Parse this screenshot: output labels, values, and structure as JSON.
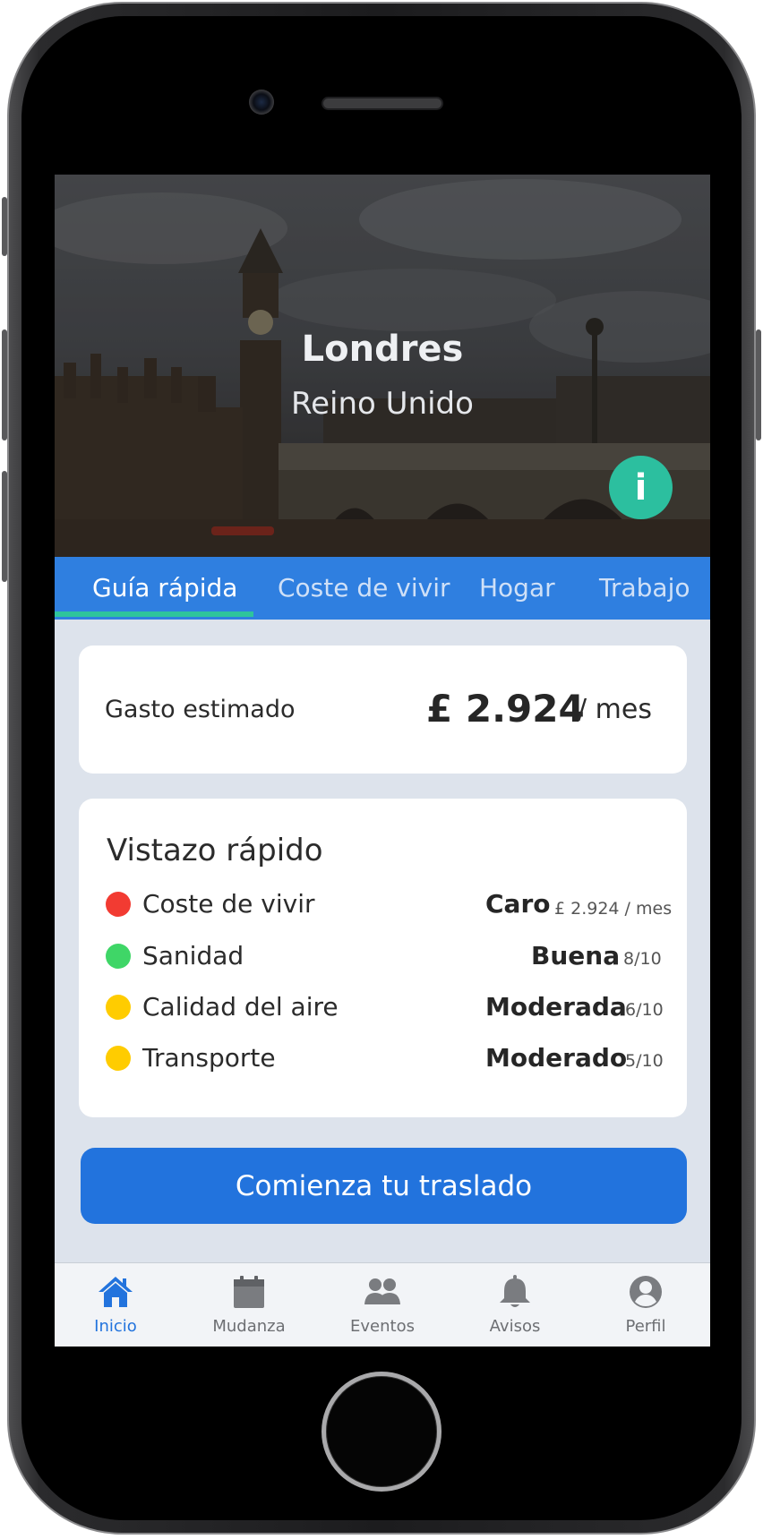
{
  "hero": {
    "city": "Londres",
    "country": "Reino Unido",
    "info_icon": "info-icon",
    "info_label": "i"
  },
  "tabs": [
    {
      "label": "Guía rápida",
      "active": true
    },
    {
      "label": "Coste de vivir",
      "active": false
    },
    {
      "label": "Hogar",
      "active": false
    },
    {
      "label": "Trabajo",
      "active": false
    }
  ],
  "gasto": {
    "label": "Gasto estimado",
    "amount": "£ 2.924",
    "period": "/ mes"
  },
  "vistazo": {
    "title": "Vistazo rápido",
    "rows": [
      {
        "label": "Coste de vivir",
        "rating": "Caro",
        "detail": "£ 2.924 / mes",
        "status_color": "#f23b32"
      },
      {
        "label": "Sanidad",
        "rating": "Buena",
        "detail": "8/10",
        "status_color": "#3fd667"
      },
      {
        "label": "Calidad del aire",
        "rating": "Moderada",
        "detail": "6/10",
        "status_color": "#ffcc00"
      },
      {
        "label": "Transporte",
        "rating": "Moderado",
        "detail": "5/10",
        "status_color": "#ffcc00"
      }
    ]
  },
  "cta": {
    "label": "Comienza tu traslado"
  },
  "nav": [
    {
      "label": "Inicio",
      "icon": "home-icon",
      "active": true
    },
    {
      "label": "Mudanza",
      "icon": "calendar-icon",
      "active": false
    },
    {
      "label": "Eventos",
      "icon": "users-icon",
      "active": false
    },
    {
      "label": "Avisos",
      "icon": "bell-icon",
      "active": false
    },
    {
      "label": "Perfil",
      "icon": "user-circle-icon",
      "active": false
    }
  ],
  "colors": {
    "primary": "#2273dd",
    "tab_bar": "#2f7fe0",
    "accent": "#2ec49b",
    "info_button": "#2cbf9f",
    "background": "#dde3ec"
  }
}
